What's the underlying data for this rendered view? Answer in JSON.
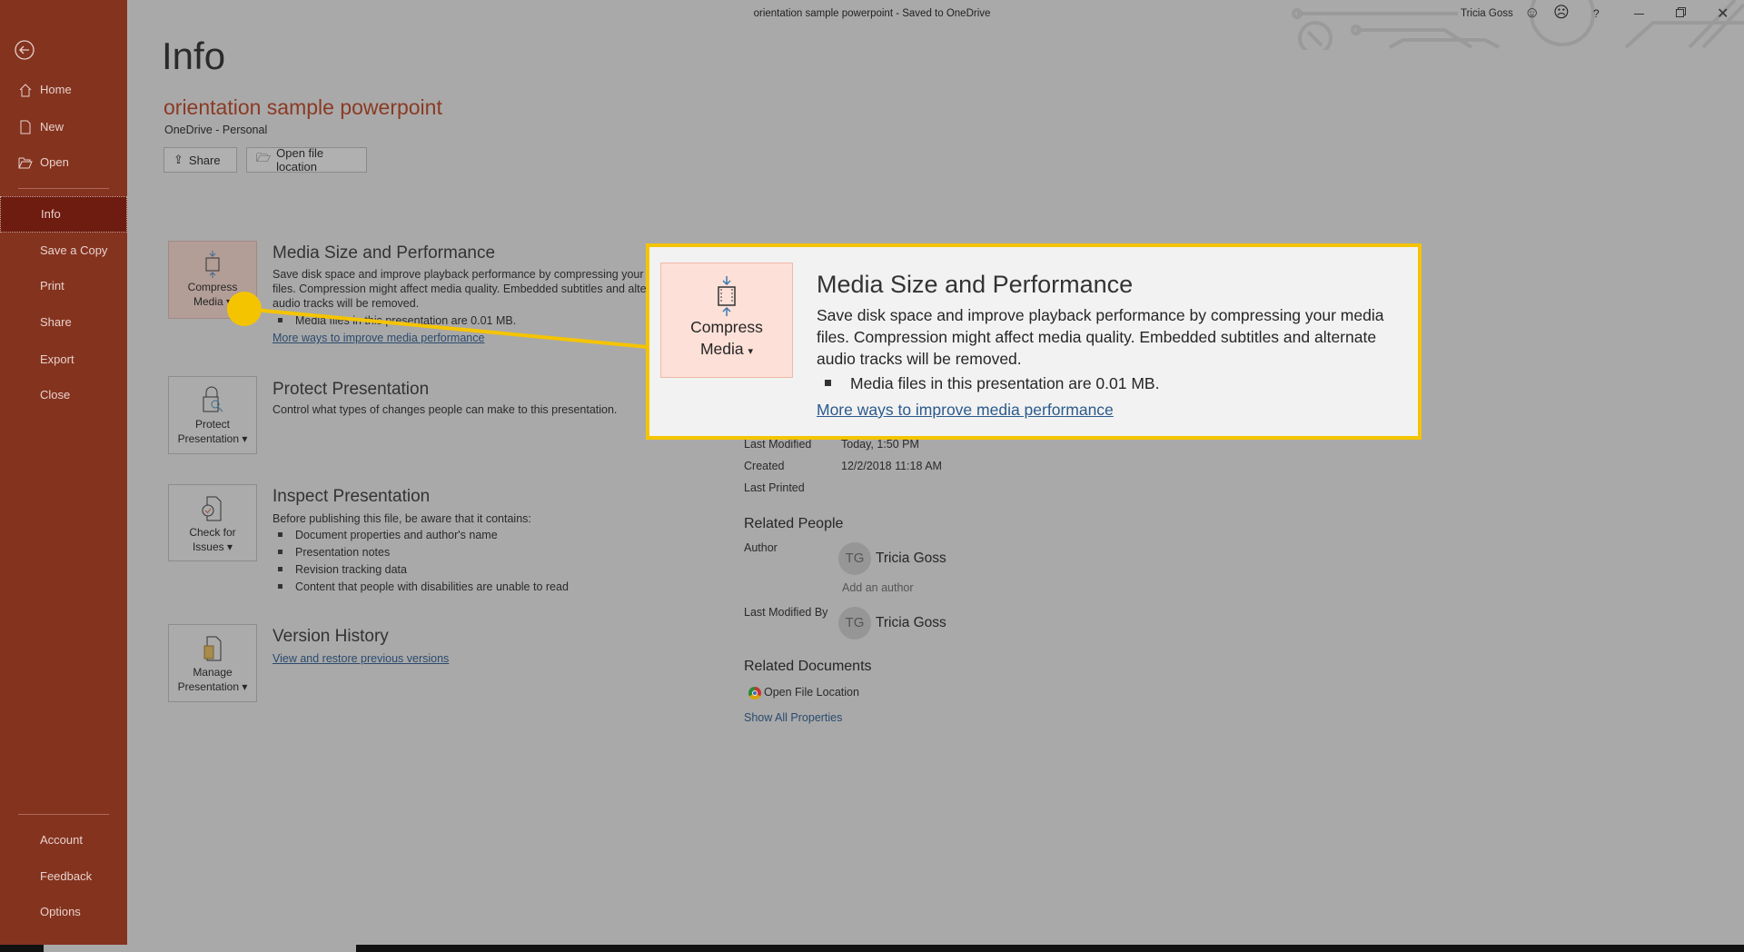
{
  "window": {
    "title": "orientation sample powerpoint  -  Saved to OneDrive",
    "user": "Tricia Goss",
    "help": "?"
  },
  "sidebar": {
    "items": [
      {
        "label": "Home",
        "icon": "home-icon"
      },
      {
        "label": "New",
        "icon": "new-document-icon"
      },
      {
        "label": "Open",
        "icon": "folder-open-icon"
      },
      {
        "label": "Info",
        "selected": true
      },
      {
        "label": "Save a Copy"
      },
      {
        "label": "Print"
      },
      {
        "label": "Share"
      },
      {
        "label": "Export"
      },
      {
        "label": "Close"
      }
    ],
    "bottom": [
      {
        "label": "Account"
      },
      {
        "label": "Feedback"
      },
      {
        "label": "Options"
      }
    ]
  },
  "main": {
    "heading": "Info",
    "doc_title": "orientation sample powerpoint",
    "location": "OneDrive - Personal",
    "share_label": "Share",
    "open_location_label": "Open file location",
    "sections": {
      "media": {
        "btn1": "Compress",
        "btn2": "Media",
        "title": "Media Size and Performance",
        "desc1": "Save disk space and improve playback performance by compressing your media",
        "desc2": "files. Compression might affect media quality. Embedded subtitles and alternate",
        "desc3": "audio tracks will be removed.",
        "bullet": "Media files in this presentation are 0.01 MB.",
        "link": "More ways to improve media performance"
      },
      "protect": {
        "btn1": "Protect",
        "btn2": "Presentation",
        "title": "Protect Presentation",
        "desc": "Control what types of changes people can make to this presentation."
      },
      "inspect": {
        "btn1": "Check for",
        "btn2": "Issues",
        "title": "Inspect Presentation",
        "desc": "Before publishing this file, be aware that it contains:",
        "bullets": [
          "Document properties and author's name",
          "Presentation notes",
          "Revision tracking data",
          "Content that people with disabilities are unable to read"
        ]
      },
      "version": {
        "btn1": "Manage",
        "btn2": "Presentation",
        "title": "Version History",
        "link": "View and restore previous versions"
      }
    }
  },
  "properties": {
    "last_modified_label": "Last Modified",
    "last_modified": "Today, 1:50 PM",
    "created_label": "Created",
    "created": "12/2/2018 11:18 AM",
    "last_printed_label": "Last Printed",
    "related_people": "Related People",
    "author_label": "Author",
    "author_initials": "TG",
    "author": "Tricia Goss",
    "add_author": "Add an author",
    "last_modified_by_label": "Last Modified By",
    "modifier_initials": "TG",
    "modifier": "Tricia Goss",
    "related_documents": "Related Documents",
    "open_file_location": "Open File Location",
    "show_all": "Show All Properties"
  },
  "colors": {
    "sidebar": "#84331f",
    "accent_title": "#8b3a24",
    "highlight": "#f5c400",
    "link": "#2b4a6e"
  }
}
